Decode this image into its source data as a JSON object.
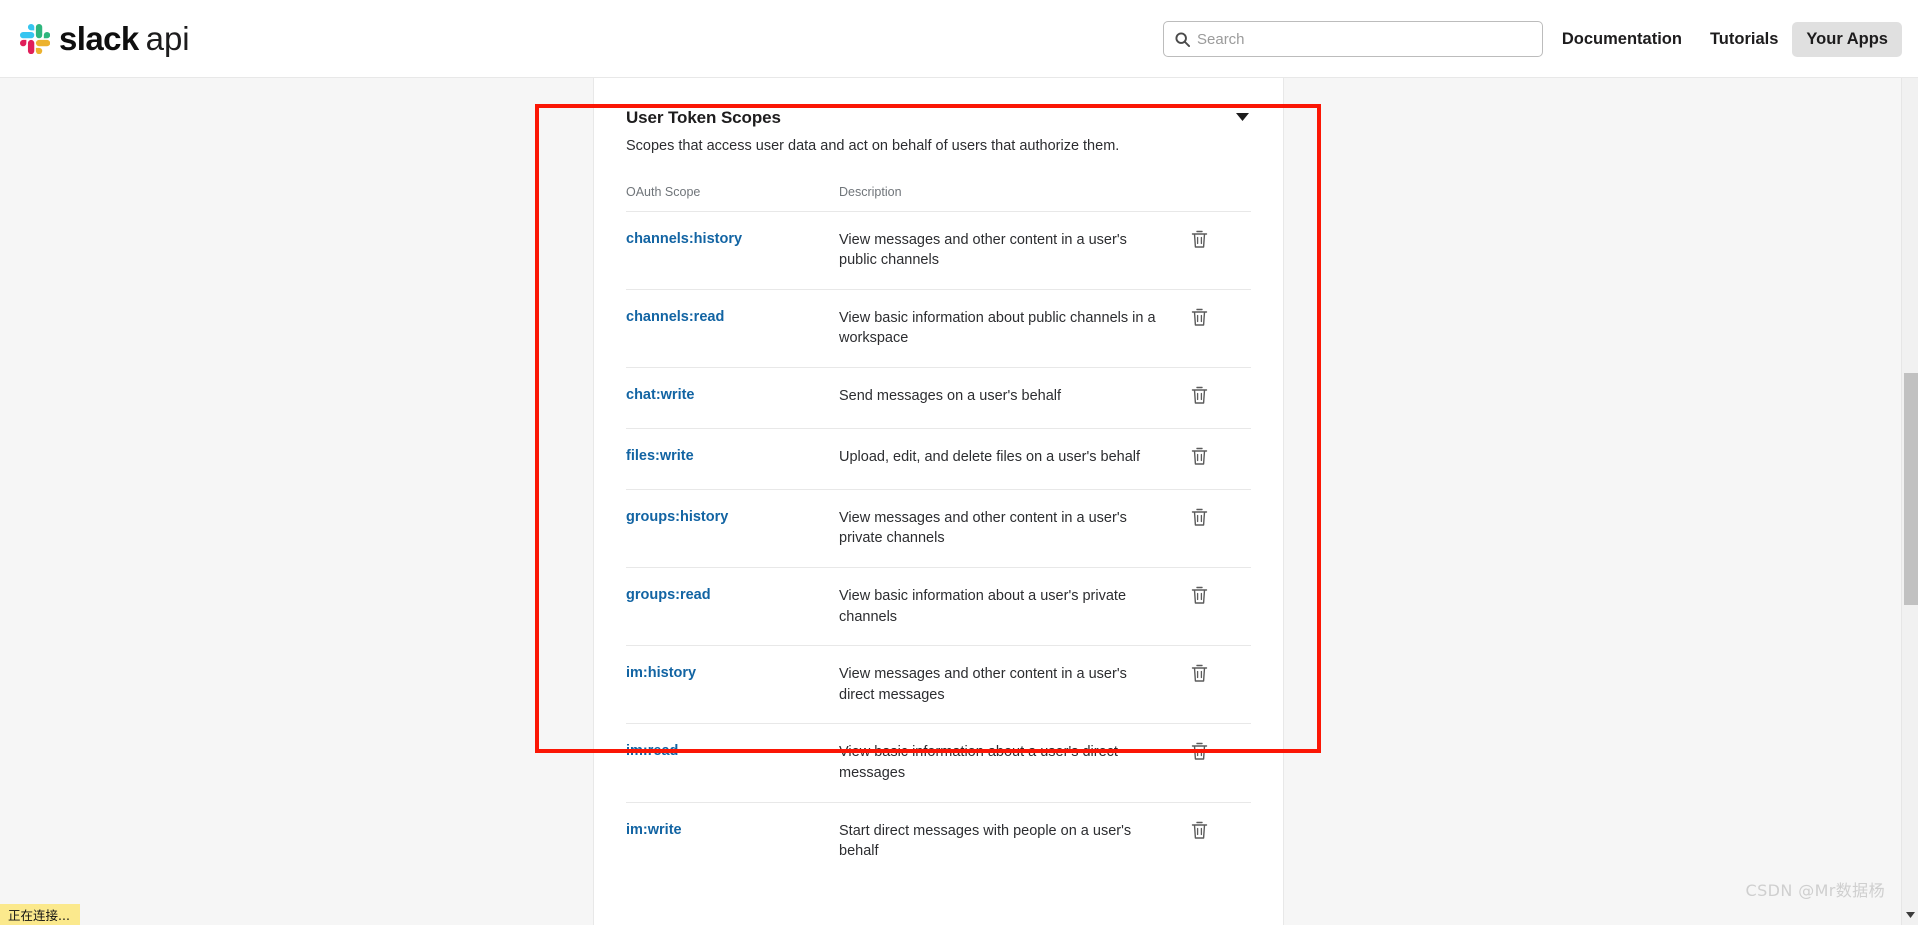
{
  "header": {
    "logo": {
      "brand": "slack",
      "product": "api",
      "icon": "slack-logo-icon"
    },
    "search": {
      "placeholder": "Search",
      "value": "",
      "icon": "search-icon"
    },
    "nav": [
      {
        "label": "Documentation",
        "active": false
      },
      {
        "label": "Tutorials",
        "active": false
      },
      {
        "label": "Your Apps",
        "active": true
      }
    ]
  },
  "card": {
    "title": "User Token Scopes",
    "subtitle": "Scopes that access user data and act on behalf of users that authorize them.",
    "collapse_icon": "chevron-down-icon",
    "columns": {
      "scope": "OAuth Scope",
      "description": "Description",
      "actions": ""
    },
    "rows": [
      {
        "scope": "channels:history",
        "description": "View messages and other content in a user's public channels",
        "delete_icon": "trash-icon"
      },
      {
        "scope": "channels:read",
        "description": "View basic information about public channels in a workspace",
        "delete_icon": "trash-icon"
      },
      {
        "scope": "chat:write",
        "description": "Send messages on a user's behalf",
        "delete_icon": "trash-icon"
      },
      {
        "scope": "files:write",
        "description": "Upload, edit, and delete files on a user's behalf",
        "delete_icon": "trash-icon"
      },
      {
        "scope": "groups:history",
        "description": "View messages and other content in a user's private channels",
        "delete_icon": "trash-icon"
      },
      {
        "scope": "groups:read",
        "description": "View basic information about a user's private channels",
        "delete_icon": "trash-icon"
      },
      {
        "scope": "im:history",
        "description": "View messages and other content in a user's direct messages",
        "delete_icon": "trash-icon"
      },
      {
        "scope": "im:read",
        "description": "View basic information about a user's direct messages",
        "delete_icon": "trash-icon"
      },
      {
        "scope": "im:write",
        "description": "Start direct messages with people on a user's behalf",
        "delete_icon": "trash-icon"
      }
    ]
  },
  "annotation": {
    "color": "#fb1605",
    "shape": "rectangle-highlight"
  },
  "status_bar": {
    "text": "正在连接..."
  },
  "watermark": {
    "text": "CSDN @Mr数据杨"
  },
  "scrollbar": {
    "orientation": "vertical",
    "arrow_icon": "chevron-down-icon"
  }
}
